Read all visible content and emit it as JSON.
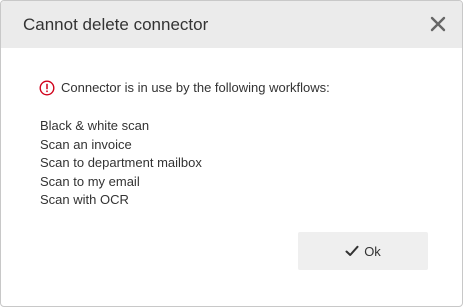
{
  "dialog": {
    "title": "Cannot delete connector",
    "close_icon": "close-icon",
    "message_icon": "exclamation-circle-icon",
    "message": "Connector is in use by the following workflows:",
    "workflows": [
      "Black & white scan",
      "Scan an invoice",
      "Scan to department mailbox",
      "Scan to my email",
      "Scan with OCR"
    ],
    "ok_button": {
      "icon": "check-icon",
      "label": "Ok"
    }
  },
  "colors": {
    "header_bg": "#ebebeb",
    "warning": "#d0021b",
    "text": "#333333",
    "button_bg": "#efefef"
  }
}
